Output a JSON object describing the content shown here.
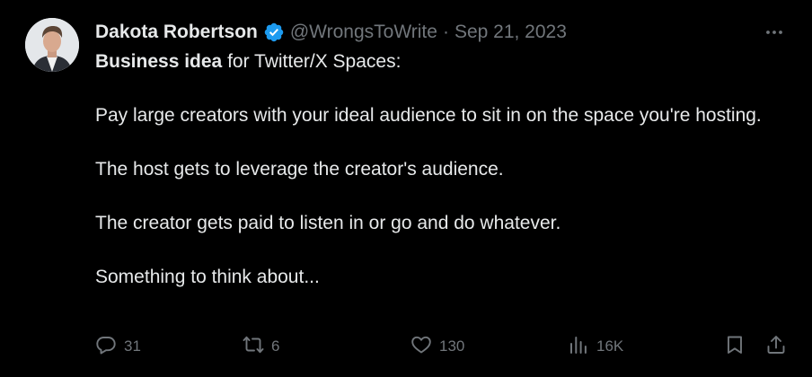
{
  "tweet": {
    "author": {
      "name": "Dakota Robertson",
      "handle": "@WrongsToWrite",
      "verified": true
    },
    "separator": "·",
    "date": "Sep 21, 2023",
    "text": {
      "line1_bold": "Business idea",
      "line1_rest": " for Twitter/X Spaces:",
      "para2": "Pay large creators with your ideal audience to sit in on the space you're hosting.",
      "para3": "The host gets to leverage the creator's audience.",
      "para4": "The creator gets paid to listen in or go and do whatever.",
      "para5": "Something to think about..."
    },
    "metrics": {
      "replies": "31",
      "reposts": "6",
      "likes": "130",
      "views": "16K"
    }
  },
  "colors": {
    "background": "#000000",
    "text_primary": "#e7e9ea",
    "text_secondary": "#71767b",
    "verified_blue": "#1d9bf0"
  },
  "icons": {
    "more": "more-dots-icon",
    "reply": "reply-icon",
    "repost": "repost-icon",
    "like": "heart-icon",
    "views": "views-icon",
    "bookmark": "bookmark-icon",
    "share": "share-icon"
  }
}
